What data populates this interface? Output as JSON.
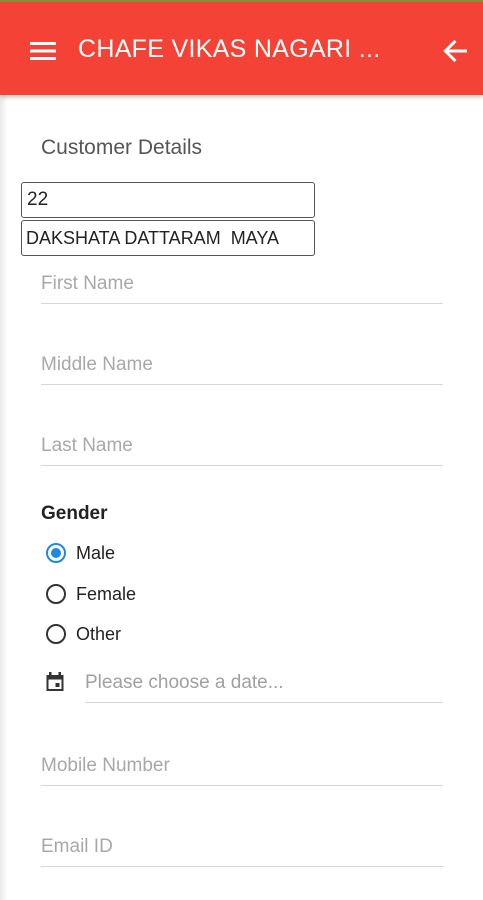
{
  "header": {
    "title": "CHAFE VIKAS NAGARI ...",
    "menu_icon": "menu-icon",
    "back_icon": "arrow-left-icon",
    "color": "#f44336"
  },
  "form": {
    "section_title": "Customer Details",
    "account_input_value": "22",
    "name_search_value": "DAKSHATA DATTARAM  MAYA",
    "first_name_placeholder": "First Name",
    "middle_name_placeholder": "Middle Name",
    "last_name_placeholder": "Last Name",
    "gender": {
      "label": "Gender",
      "options": [
        "Male",
        "Female",
        "Other"
      ],
      "selected": "Male"
    },
    "date_placeholder": "Please choose a date...",
    "mobile_placeholder": "Mobile Number",
    "email_placeholder": "Email ID"
  },
  "colors": {
    "accent": "#1e88e5",
    "header": "#f44336"
  }
}
